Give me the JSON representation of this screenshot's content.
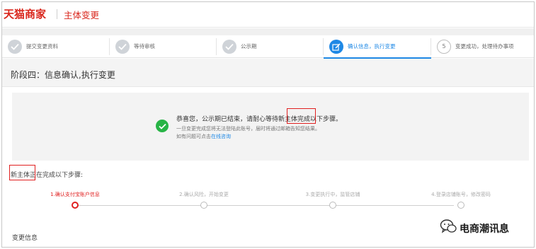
{
  "header": {
    "brand": "天猫商家",
    "title": "主体变更"
  },
  "stepper": [
    {
      "label": "提交变更资料",
      "state": "done"
    },
    {
      "label": "等待审核",
      "state": "done"
    },
    {
      "label": "公示期",
      "state": "done"
    },
    {
      "label": "确认信息，执行变更",
      "state": "active"
    },
    {
      "label": "变更成功，处理待办事项",
      "state": "pending",
      "number": "5"
    }
  ],
  "stage_title": "阶段四：信息确认,执行变更",
  "notice": {
    "main_prefix": "恭喜您，公示期已结束，请耐心等待",
    "main_highlight": "新主体",
    "main_suffix": "完成以下步骤。",
    "sub": "一旦变更完成您将无法登陆此账号，届时将通过邮箱告知您结果。",
    "help_prefix": "如有问题可点击",
    "help_link": "在线咨询"
  },
  "progress": {
    "heading_highlight": "新主体",
    "heading_suffix": "正在完成以下步骤:",
    "steps": [
      {
        "label": "1.确认支付宝账户信息",
        "active": true
      },
      {
        "label": "2.确认风险，开始变更",
        "active": false
      },
      {
        "label": "3.变更执行中，监管店铺",
        "active": false
      },
      {
        "label": "4.登录店铺账号，修改密码",
        "active": false
      }
    ]
  },
  "section_title": "变更信息",
  "watermark": "电商潮讯息",
  "colors": {
    "brand_red": "#d9261c",
    "active_blue": "#1e88e5",
    "success_green": "#28b446",
    "highlight_red": "#e02020"
  }
}
